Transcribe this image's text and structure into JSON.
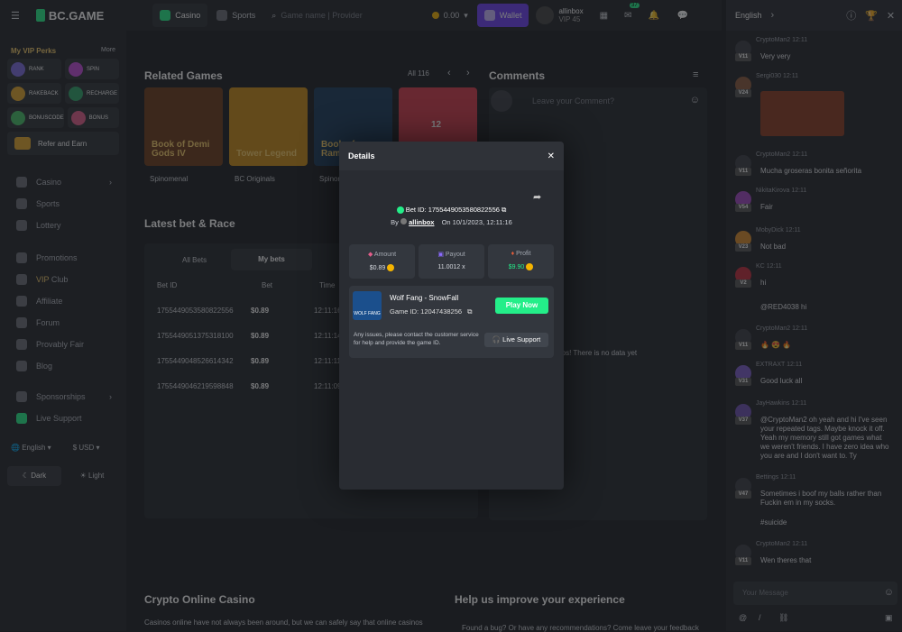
{
  "topbar": {
    "logo": "BC.GAME",
    "tab_casino": "Casino",
    "tab_sports": "Sports",
    "search_placeholder": "Game name | Provider",
    "balance": "0.00",
    "wallet": "Wallet",
    "username": "allinbox",
    "vip": "VIP 45",
    "mail_badge": "37"
  },
  "sidebar": {
    "vip_perks": "My VIP Perks",
    "more": "More",
    "perks": [
      "RANK",
      "SPIN",
      "RAKEBACK",
      "RECHARGE",
      "BONUSCODE",
      "BONUS"
    ],
    "refer": "Refer and Earn",
    "nav": [
      "Casino",
      "Sports",
      "Lottery",
      "Promotions",
      "VIP Club",
      "Affiliate",
      "Forum",
      "Provably Fair",
      "Blog",
      "Sponsorships",
      "Live Support"
    ],
    "vip_club_prefix": "VIP",
    "vip_club_suffix": "Club",
    "language": "English",
    "currency": "$ USD",
    "dark": "Dark",
    "light": "Light"
  },
  "main": {
    "related_games": "Related Games",
    "all": "All 116",
    "games": [
      {
        "title": "Book of Demi Gods IV",
        "provider": "Spinomenal"
      },
      {
        "title": "Tower Legend",
        "provider": "BC Originals"
      },
      {
        "title": "Book of Rampage",
        "provider": "Spinomenal"
      },
      {
        "title": "12",
        "provider": ""
      }
    ],
    "latest_bet": "Latest bet & Race",
    "tabs": [
      "All Bets",
      "My bets"
    ],
    "headers": [
      "Bet ID",
      "Bet",
      "Time"
    ],
    "rows": [
      {
        "id": "1755449053580822556",
        "bet": "$0.89",
        "time": "12:11:16"
      },
      {
        "id": "1755449051375318100",
        "bet": "$0.89",
        "time": "12:11:14"
      },
      {
        "id": "1755449048526614342",
        "bet": "$0.89",
        "time": "12:11:11"
      },
      {
        "id": "1755449046219598848",
        "bet": "$0.89",
        "time": "12:11:09"
      }
    ],
    "comments": "Comments",
    "comment_placeholder": "Leave your Comment?",
    "no_comments": "Oops! There is no data yet",
    "crypto_title": "Crypto Online Casino",
    "crypto_text": "Casinos online have not always been around, but we can safely say that online casinos",
    "help_title": "Help us improve your experience",
    "help_text": "Found a bug? Or have any recommendations? Come leave your feedback"
  },
  "modal": {
    "title": "Details",
    "bet_id": "Bet ID: 1755449053580822556",
    "by": "By",
    "user": "allinbox",
    "on": "On 10/1/2023, 12:11:16",
    "amount_label": "Amount",
    "amount": "$0.89",
    "payout_label": "Payout",
    "payout": "11.0012 x",
    "profit_label": "Profit",
    "profit": "$9.90",
    "game": "Wolf Fang - SnowFall",
    "game_id": "Game ID: 12047438256",
    "play": "Play Now",
    "issue": "Any issues, please contact the customer service for help and provide the game ID.",
    "support": "Live Support",
    "game_thumb": "WOLF FANG"
  },
  "chat": {
    "language": "English",
    "input_placeholder": "Your Message",
    "messages": [
      {
        "user": "CryptoMan2",
        "time": "12:11",
        "lvl": "V11",
        "text": "Very very"
      },
      {
        "user": "Sergi030",
        "time": "12:11",
        "lvl": "V24",
        "text": ""
      },
      {
        "user": "CryptoMan2",
        "time": "12:11",
        "lvl": "V11",
        "text": "Mucha groseras bonita señorita"
      },
      {
        "user": "NikitaKirova",
        "time": "12:11",
        "lvl": "V54",
        "text": "Fair"
      },
      {
        "user": "MobyDick",
        "time": "12:11",
        "lvl": "V23",
        "text": "Not bad"
      },
      {
        "user": "KC",
        "time": "12:11",
        "lvl": "V2",
        "text": "hi"
      },
      {
        "user": "",
        "time": "",
        "lvl": "",
        "text": "@RED4038 hi"
      },
      {
        "user": "CryptoMan2",
        "time": "12:11",
        "lvl": "V11",
        "text": "🔥 😍 🔥"
      },
      {
        "user": "EXTRAXT",
        "time": "12:11",
        "lvl": "V31",
        "text": "Good luck all"
      },
      {
        "user": "JayHawkins",
        "time": "12:11",
        "lvl": "V37",
        "text": "@CryptoMan2 oh yeah and hi I've seen your repeated tags. Maybe knock it off. Yeah my memory still got games what we weren't friends. I have zero idea who you are and I don't want to. Ty"
      },
      {
        "user": "Bettings",
        "time": "12:11",
        "lvl": "V47",
        "text": "Sometimes i boof my balls rather than Fuckin em in my socks."
      },
      {
        "user": "",
        "time": "",
        "lvl": "",
        "text": "#suicide"
      },
      {
        "user": "CryptoMan2",
        "time": "12:11",
        "lvl": "V11",
        "text": "Wen theres that"
      }
    ]
  },
  "colors": {
    "green": "#24ee89",
    "accent": "#6b3ff2",
    "gold": "#f5b400"
  }
}
